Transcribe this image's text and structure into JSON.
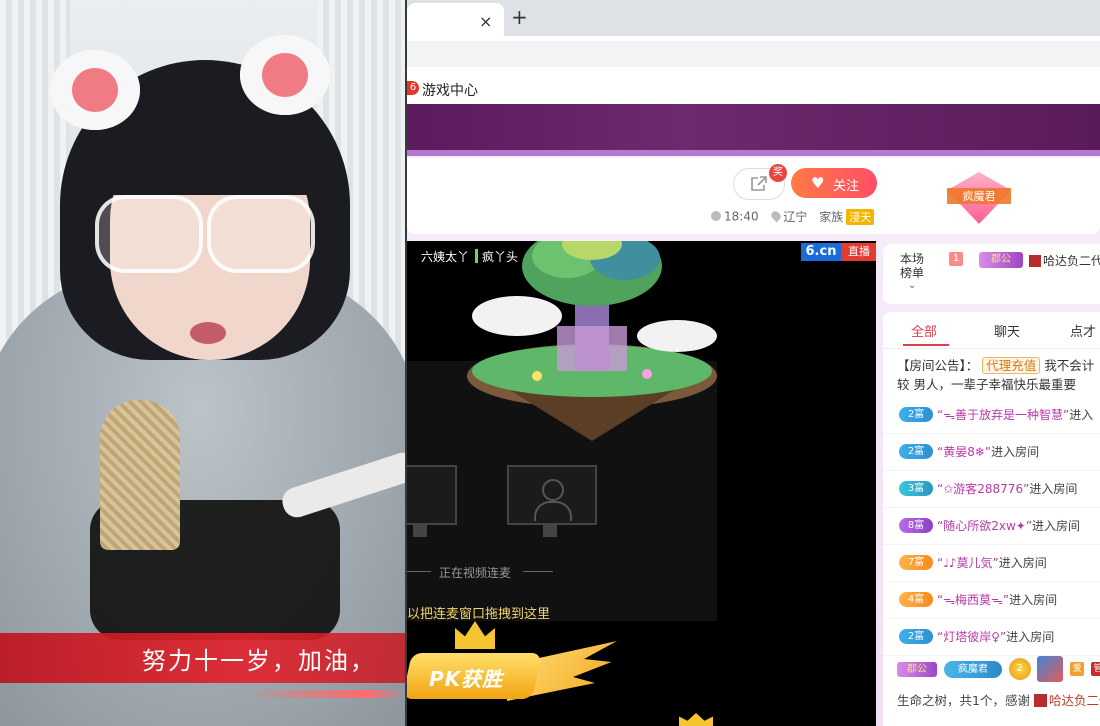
{
  "webcam": {
    "caption": "努力十一岁，加油，"
  },
  "browser": {
    "close_glyph": "×",
    "new_tab_glyph": "+",
    "bookmark": {
      "icon_text": "6",
      "label": "游戏中心"
    }
  },
  "room": {
    "share_badge": "奖",
    "follow_label": "关注",
    "time": "18:40",
    "location": "辽宁",
    "family_label": "家族",
    "family_tag": "浸天",
    "gem_label": "疯魔君"
  },
  "stage": {
    "anchor_a": "六姨太丫",
    "anchor_b": "疯丫头",
    "logo_site": "6.cn",
    "logo_live": "直播",
    "linking_text": "正在视频连麦",
    "drag_hint": "以把连麦窗口拖拽到这里",
    "pk_label": "PK获胜"
  },
  "rank": {
    "label": "本场榜单",
    "position": "1",
    "badge": "郡公",
    "top_user": "哈达负二代"
  },
  "chat": {
    "tabs": [
      "全部",
      "聊天",
      "点才"
    ],
    "notice_prefix": "【房间公告】：",
    "notice_tag": "代理充值",
    "notice_rest": "我不会计较 男人，一辈子幸福快乐最重要",
    "messages": [
      {
        "level": "2富",
        "color": "blue",
        "name": "“ᯓ善于放弃是一种智慧”",
        "action": "进入"
      },
      {
        "level": "2富",
        "color": "blue",
        "name": "“黄晏8❄”",
        "action": "进入房间"
      },
      {
        "level": "3富",
        "color": "teal",
        "name": "“✩游客288776”",
        "action": "进入房间"
      },
      {
        "level": "8富",
        "color": "purple",
        "name": "“随心所欲2xw✦”",
        "action": "进入房间"
      },
      {
        "level": "7富",
        "color": "orange",
        "name": "“♩♪莫儿気”",
        "action": "进入房间"
      },
      {
        "level": "4富",
        "color": "orange",
        "name": "“ᯓ梅西莫ᯓ”",
        "action": "进入房间"
      },
      {
        "level": "2富",
        "color": "blue",
        "name": "“灯塔彼岸♀”",
        "action": "进入房间"
      }
    ],
    "gift_row": {
      "badge1": "郡公",
      "badge2": "疯魔君",
      "medal": "2",
      "tag_r": "爱",
      "tag_m": "管"
    },
    "gift_text": "生命之树，共1个，感谢",
    "gift_user": "哈达负二代"
  }
}
